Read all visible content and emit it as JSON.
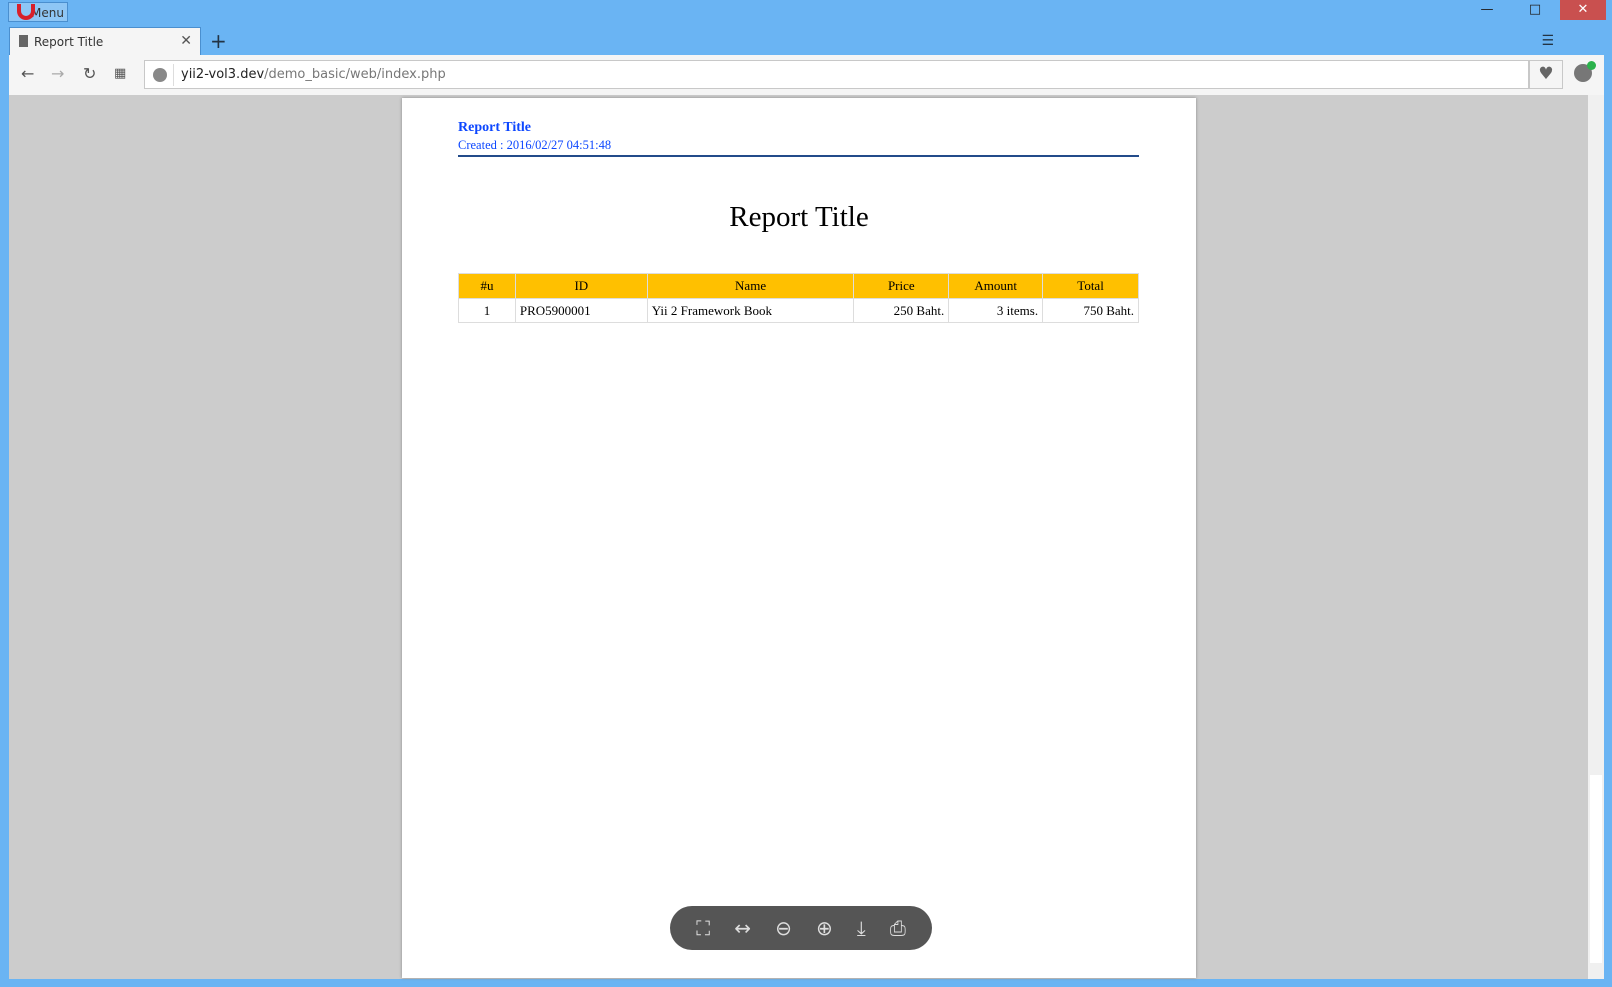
{
  "browser": {
    "menu_label": "Menu",
    "tab_title": "Report Title",
    "url_host": "yii2-vol3.dev",
    "url_path": "/demo_basic/web/index.php"
  },
  "report": {
    "header_title": "Report Title",
    "created": "Created : 2016/02/27 04:51:48",
    "title": "Report Title",
    "columns": [
      "#u",
      "ID",
      "Name",
      "Price",
      "Amount",
      "Total"
    ],
    "rows": [
      [
        "1",
        "PRO5900001",
        "Yii 2 Framework Book",
        "250 Baht.",
        "3 items.",
        "750 Baht."
      ]
    ],
    "header_color": "#ffc000"
  },
  "pdf_toolbar": [
    "fit-page-icon",
    "fit-width-icon",
    "zoom-out-icon",
    "zoom-in-icon",
    "download-icon",
    "print-icon"
  ]
}
